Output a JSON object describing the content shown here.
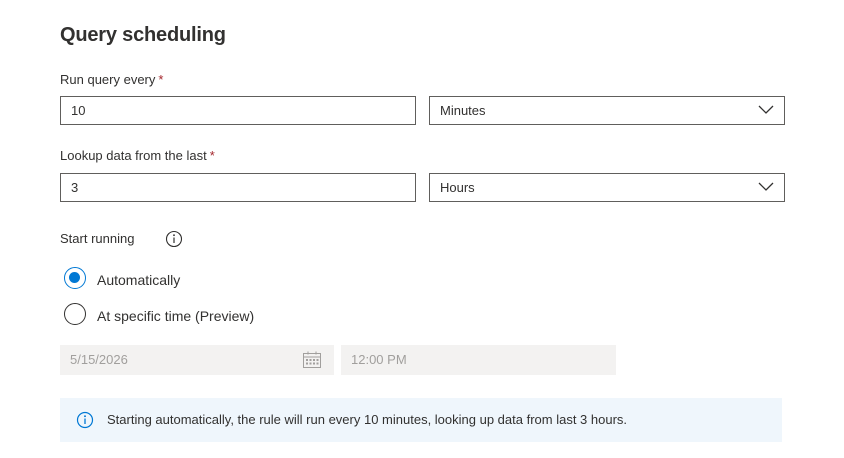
{
  "section": {
    "title": "Query scheduling"
  },
  "run_query": {
    "label": "Run query every",
    "required_mark": "*",
    "value": "10",
    "unit": "Minutes"
  },
  "lookup": {
    "label": "Lookup data from the last",
    "required_mark": "*",
    "value": "3",
    "unit": "Hours"
  },
  "start_running": {
    "label": "Start running",
    "options": [
      {
        "label": "Automatically",
        "selected": true
      },
      {
        "label": "At specific time (Preview)",
        "selected": false
      }
    ],
    "date_value": "5/15/2026",
    "time_value": "12:00 PM"
  },
  "info": {
    "message": "Starting automatically, the rule will run every 10 minutes, looking up data from last 3 hours."
  },
  "colors": {
    "accent": "#0078d4",
    "required": "#a4262c",
    "info_background": "#eff6fc",
    "disabled_background": "#f3f2f1"
  }
}
